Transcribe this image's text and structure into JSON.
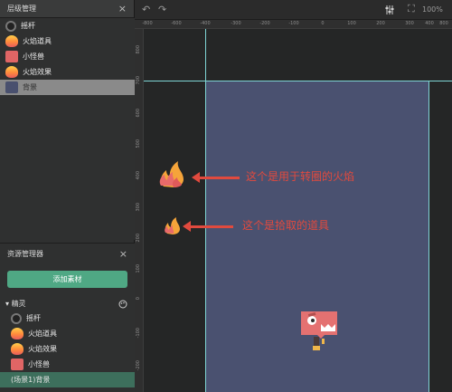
{
  "layers_panel": {
    "title": "层级管理",
    "items": [
      {
        "label": "摇杆",
        "icon": "joystick-icon"
      },
      {
        "label": "火焰道具",
        "icon": "fire-icon"
      },
      {
        "label": "小怪兽",
        "icon": "monster-icon"
      },
      {
        "label": "火焰效果",
        "icon": "fire-icon"
      },
      {
        "label": "背景",
        "icon": "background-icon",
        "selected": true
      }
    ]
  },
  "resource_panel": {
    "title": "资源管理器",
    "add_button": "添加素材",
    "section": "精灵",
    "items": [
      {
        "label": "摇杆"
      },
      {
        "label": "火焰道具"
      },
      {
        "label": "火焰效果"
      },
      {
        "label": "小怪兽"
      },
      {
        "label": "(场景1)背景"
      }
    ]
  },
  "ruler": {
    "x_ticks": [
      "-800",
      "-600",
      "-400",
      "-300",
      "-200",
      "-100",
      "0",
      "100",
      "200",
      "300",
      "400",
      "800"
    ],
    "y_ticks": [
      "800",
      "700",
      "600",
      "500",
      "400",
      "300",
      "200",
      "100",
      "0",
      "-100",
      "-200"
    ]
  },
  "toolbar": {
    "zoom": "100%"
  },
  "annotations": {
    "fire_effect": "这个是用于转圈的火焰",
    "fire_prop": "这个是拾取的道具"
  },
  "colors": {
    "accent": "#4fa884",
    "stage": "#4a5170",
    "guide": "#7fd5d5",
    "annotation": "#e14a3e"
  }
}
